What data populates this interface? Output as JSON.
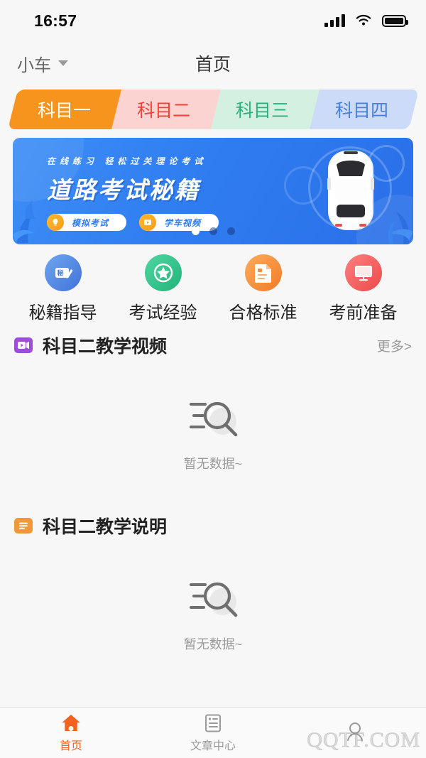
{
  "status_bar": {
    "time": "16:57",
    "signal_icon": "signal-bars-icon",
    "wifi_icon": "wifi-icon",
    "battery_icon": "battery-full-icon"
  },
  "header": {
    "vehicle_type": "小车",
    "dropdown_icon": "chevron-down-icon",
    "title": "首页"
  },
  "subject_tabs": {
    "active_index": 0,
    "items": [
      {
        "label": "科目一",
        "bg": "#f7941e",
        "fg": "#ffffff"
      },
      {
        "label": "科目二",
        "bg": "#fbd4d2",
        "fg": "#ef4136"
      },
      {
        "label": "科目三",
        "bg": "#d3f0e0",
        "fg": "#26b37a"
      },
      {
        "label": "科目四",
        "bg": "#ccdcf8",
        "fg": "#4a80d8"
      }
    ]
  },
  "banner": {
    "subtitle": "在线练习  轻松过关理论考试",
    "title": "道路考试秘籍",
    "buttons": [
      {
        "label": "模拟考试",
        "icon": "bulb-icon"
      },
      {
        "label": "学车视频",
        "icon": "play-icon"
      }
    ],
    "car_illustration": "car-top-view-icon",
    "dots_total": 3,
    "dots_active": 1,
    "bg_color": "#2f7df0"
  },
  "quick_links": [
    {
      "label": "秘籍指导",
      "icon": "book-pen-icon",
      "color": "#4e8ae8"
    },
    {
      "label": "考试经验",
      "icon": "star-icon",
      "color": "#2dbd85"
    },
    {
      "label": "合格标准",
      "icon": "document-icon",
      "color": "#f2903c"
    },
    {
      "label": "考前准备",
      "icon": "monitor-icon",
      "color": "#ef5a5a"
    }
  ],
  "sections": [
    {
      "title": "科目二教学视频",
      "icon": "video-icon",
      "icon_color": "#9c4ddb",
      "more_label": "更多>",
      "has_more": true,
      "empty_text": "暂无数据~",
      "empty_icon": "no-data-search-icon"
    },
    {
      "title": "科目二教学说明",
      "icon": "list-doc-icon",
      "icon_color": "#f2983c",
      "more_label": "",
      "has_more": false,
      "empty_text": "暂无数据~",
      "empty_icon": "no-data-search-icon"
    }
  ],
  "tabbar": {
    "active_index": 0,
    "active_color": "#f5621f",
    "inactive_color": "#999999",
    "items": [
      {
        "label": "首页",
        "icon": "home-icon"
      },
      {
        "label": "文章中心",
        "icon": "article-icon"
      },
      {
        "label": "",
        "icon": "person-icon"
      }
    ]
  },
  "watermark": "QQTF.COM"
}
